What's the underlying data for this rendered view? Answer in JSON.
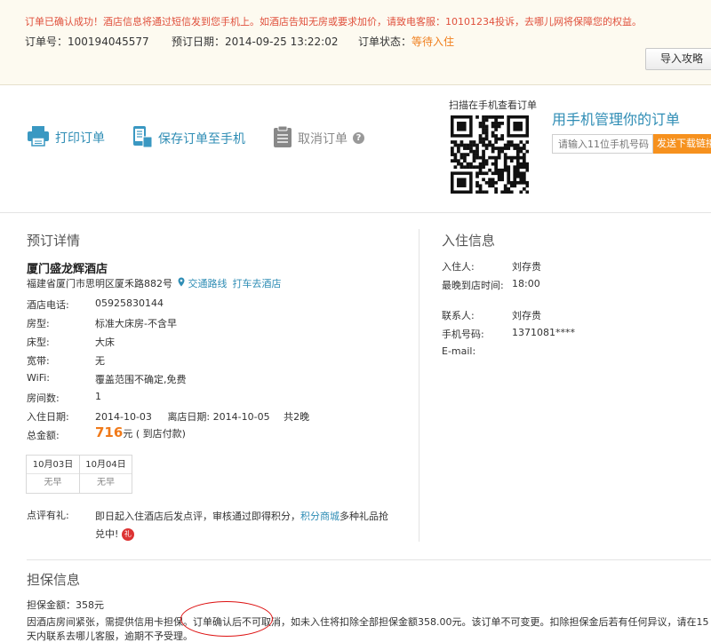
{
  "banner": {
    "notice": "订单已确认成功！酒店信息将通过短信发到您手机上。如酒店告知无房或要求加价，请致电客服：10101234投诉，去哪儿网将保障您的权益。",
    "order_no_label": "订单号：",
    "order_no": "100194045577",
    "order_date_label": "预订日期：",
    "order_date": "2014-09-25 13:22:02",
    "status_label": "订单状态：",
    "status": "等待入住",
    "import_button": "导入攻略"
  },
  "actions": {
    "print": "打印订单",
    "save_to_phone": "保存订单至手机",
    "cancel": "取消订单",
    "qr_caption": "扫描在手机查看订单",
    "manage_title": "用手机管理你的订单",
    "phone_placeholder": "请输入11位手机号码",
    "send_button": "发送下载链接"
  },
  "details": {
    "title": "预订详情",
    "hotel_name": "厦门盛龙辉酒店",
    "address": "福建省厦门市思明区厦禾路882号",
    "traffic_link": "交通路线",
    "taxi_link": "打车去酒店",
    "rows": [
      {
        "label": "酒店电话:",
        "value": "05925830144"
      },
      {
        "label": "房型:",
        "value": "标准大床房-不含早"
      },
      {
        "label": "床型:",
        "value": "大床"
      },
      {
        "label": "宽带:",
        "value": "无"
      },
      {
        "label": "WiFi:",
        "value": "覆盖范围不确定,免费"
      },
      {
        "label": "房间数:",
        "value": "1"
      }
    ],
    "checkin_label": "入住日期:",
    "checkin": "2014-10-03",
    "checkout_label": "离店日期:",
    "checkout": "2014-10-05",
    "nights": "共2晚",
    "total_label": "总金额:",
    "total_price": "716",
    "total_unit": "元",
    "total_note": "( 到店付款)",
    "calendar": [
      {
        "date": "10月03日",
        "meal": "无早"
      },
      {
        "date": "10月04日",
        "meal": "无早"
      }
    ],
    "review_label": "点评有礼:",
    "review_text_1": "即日起入住酒店后发点评，审核通过即得积分，",
    "review_link": "积分商城",
    "review_text_2": "多种礼品抢兑中!",
    "gift_icon_text": "礼"
  },
  "checkin_info": {
    "title": "入住信息",
    "rows": [
      {
        "label": "入住人:",
        "value": "刘存贵"
      },
      {
        "label": "最晚到店时间:",
        "value": "18:00"
      },
      {
        "label": "联系人:",
        "value": "刘存贵"
      },
      {
        "label": "手机号码:",
        "value": "1371081****"
      },
      {
        "label": "E-mail:",
        "value": ""
      }
    ]
  },
  "guarantee": {
    "title": "担保信息",
    "amount_line": "担保金额：358元",
    "text_1": "因酒店房间紧张，需提供信用卡担保。",
    "text_highlight": "订单确认后不可取消",
    "text_2": "，如未入住将扣除全部担保金额358.00元。该订单不可变更。扣除担保金后若有任何异议，请在15天内联系去哪儿客服，逾期不予受理。"
  },
  "colors": {
    "link": "#2f8db5",
    "notice": "#e0503c",
    "accent": "#f6911e",
    "price": "#f07a1a"
  }
}
